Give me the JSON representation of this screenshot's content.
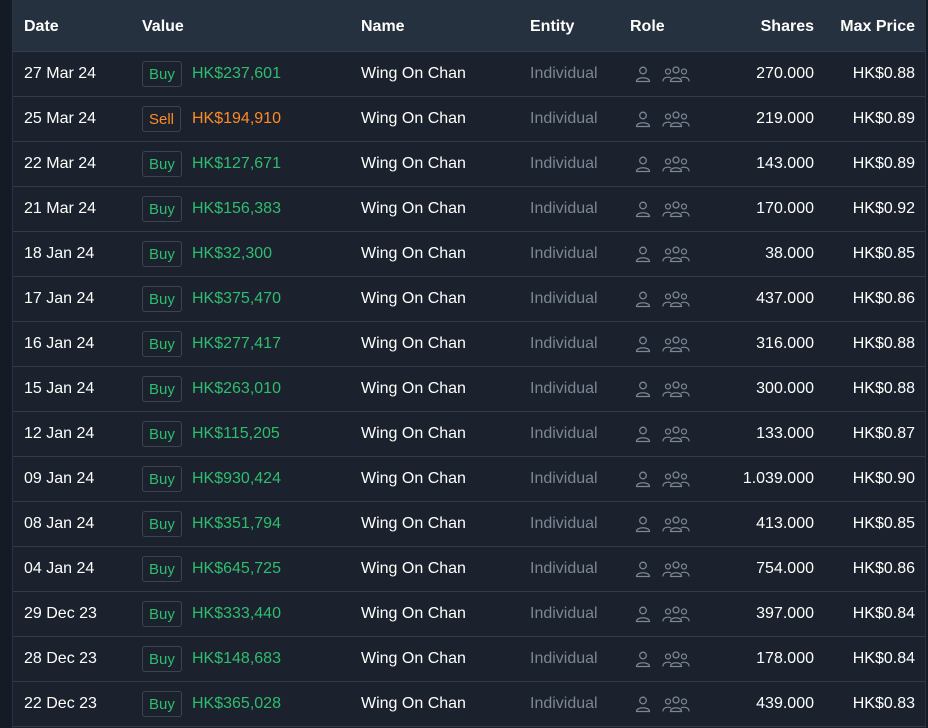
{
  "header": {
    "date": "Date",
    "value": "Value",
    "name": "Name",
    "entity": "Entity",
    "role": "Role",
    "shares": "Shares",
    "max_price": "Max Price"
  },
  "colors": {
    "buy": "#2ebd6f",
    "sell": "#ff8a26",
    "header_bg": "#263140",
    "row_bg": "#1b222d"
  },
  "icons": {
    "role_individual": "person-icon",
    "role_group": "group-icon"
  },
  "rows": [
    {
      "date": "27 Mar 24",
      "action": "Buy",
      "type": "buy",
      "value": "HK$237,601",
      "name": "Wing On Chan",
      "entity": "Individual",
      "shares": "270.000",
      "max_price": "HK$0.88"
    },
    {
      "date": "25 Mar 24",
      "action": "Sell",
      "type": "sell",
      "value": "HK$194,910",
      "name": "Wing On Chan",
      "entity": "Individual",
      "shares": "219.000",
      "max_price": "HK$0.89"
    },
    {
      "date": "22 Mar 24",
      "action": "Buy",
      "type": "buy",
      "value": "HK$127,671",
      "name": "Wing On Chan",
      "entity": "Individual",
      "shares": "143.000",
      "max_price": "HK$0.89"
    },
    {
      "date": "21 Mar 24",
      "action": "Buy",
      "type": "buy",
      "value": "HK$156,383",
      "name": "Wing On Chan",
      "entity": "Individual",
      "shares": "170.000",
      "max_price": "HK$0.92"
    },
    {
      "date": "18 Jan 24",
      "action": "Buy",
      "type": "buy",
      "value": "HK$32,300",
      "name": "Wing On Chan",
      "entity": "Individual",
      "shares": "38.000",
      "max_price": "HK$0.85"
    },
    {
      "date": "17 Jan 24",
      "action": "Buy",
      "type": "buy",
      "value": "HK$375,470",
      "name": "Wing On Chan",
      "entity": "Individual",
      "shares": "437.000",
      "max_price": "HK$0.86"
    },
    {
      "date": "16 Jan 24",
      "action": "Buy",
      "type": "buy",
      "value": "HK$277,417",
      "name": "Wing On Chan",
      "entity": "Individual",
      "shares": "316.000",
      "max_price": "HK$0.88"
    },
    {
      "date": "15 Jan 24",
      "action": "Buy",
      "type": "buy",
      "value": "HK$263,010",
      "name": "Wing On Chan",
      "entity": "Individual",
      "shares": "300.000",
      "max_price": "HK$0.88"
    },
    {
      "date": "12 Jan 24",
      "action": "Buy",
      "type": "buy",
      "value": "HK$115,205",
      "name": "Wing On Chan",
      "entity": "Individual",
      "shares": "133.000",
      "max_price": "HK$0.87"
    },
    {
      "date": "09 Jan 24",
      "action": "Buy",
      "type": "buy",
      "value": "HK$930,424",
      "name": "Wing On Chan",
      "entity": "Individual",
      "shares": "1.039.000",
      "max_price": "HK$0.90"
    },
    {
      "date": "08 Jan 24",
      "action": "Buy",
      "type": "buy",
      "value": "HK$351,794",
      "name": "Wing On Chan",
      "entity": "Individual",
      "shares": "413.000",
      "max_price": "HK$0.85"
    },
    {
      "date": "04 Jan 24",
      "action": "Buy",
      "type": "buy",
      "value": "HK$645,725",
      "name": "Wing On Chan",
      "entity": "Individual",
      "shares": "754.000",
      "max_price": "HK$0.86"
    },
    {
      "date": "29 Dec 23",
      "action": "Buy",
      "type": "buy",
      "value": "HK$333,440",
      "name": "Wing On Chan",
      "entity": "Individual",
      "shares": "397.000",
      "max_price": "HK$0.84"
    },
    {
      "date": "28 Dec 23",
      "action": "Buy",
      "type": "buy",
      "value": "HK$148,683",
      "name": "Wing On Chan",
      "entity": "Individual",
      "shares": "178.000",
      "max_price": "HK$0.84"
    },
    {
      "date": "22 Dec 23",
      "action": "Buy",
      "type": "buy",
      "value": "HK$365,028",
      "name": "Wing On Chan",
      "entity": "Individual",
      "shares": "439.000",
      "max_price": "HK$0.83"
    }
  ]
}
